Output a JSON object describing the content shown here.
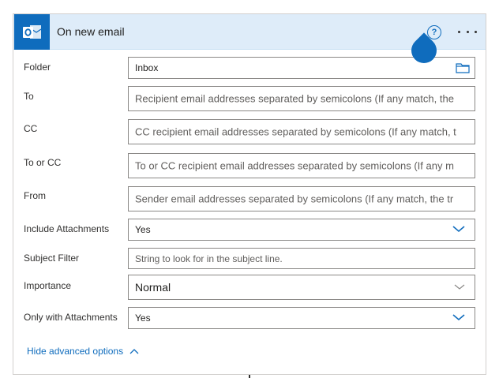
{
  "header": {
    "title": "On new email",
    "help_symbol": "?",
    "app_icon": "outlook-icon",
    "accent": "#0f6cbd",
    "background": "#deecf9"
  },
  "fields": {
    "folder": {
      "label": "Folder",
      "value": "Inbox",
      "icon": "folder-icon"
    },
    "to": {
      "label": "To",
      "placeholder": "Recipient email addresses separated by semicolons (If any match, the"
    },
    "cc": {
      "label": "CC",
      "placeholder": "CC recipient email addresses separated by semicolons (If any match, t"
    },
    "to_or_cc": {
      "label": "To or CC",
      "placeholder": "To or CC recipient email addresses separated by semicolons (If any m"
    },
    "from": {
      "label": "From",
      "placeholder": "Sender email addresses separated by semicolons (If any match, the tr"
    },
    "include_attachments": {
      "label": "Include Attachments",
      "value": "Yes"
    },
    "subject_filter": {
      "label": "Subject Filter",
      "placeholder": "String to look for in the subject line."
    },
    "importance": {
      "label": "Importance",
      "value": "Normal"
    },
    "only_with_attachments": {
      "label": "Only with Attachments",
      "value": "Yes"
    }
  },
  "advanced_toggle": {
    "label": "Hide advanced options",
    "icon": "chevron-up-icon"
  }
}
